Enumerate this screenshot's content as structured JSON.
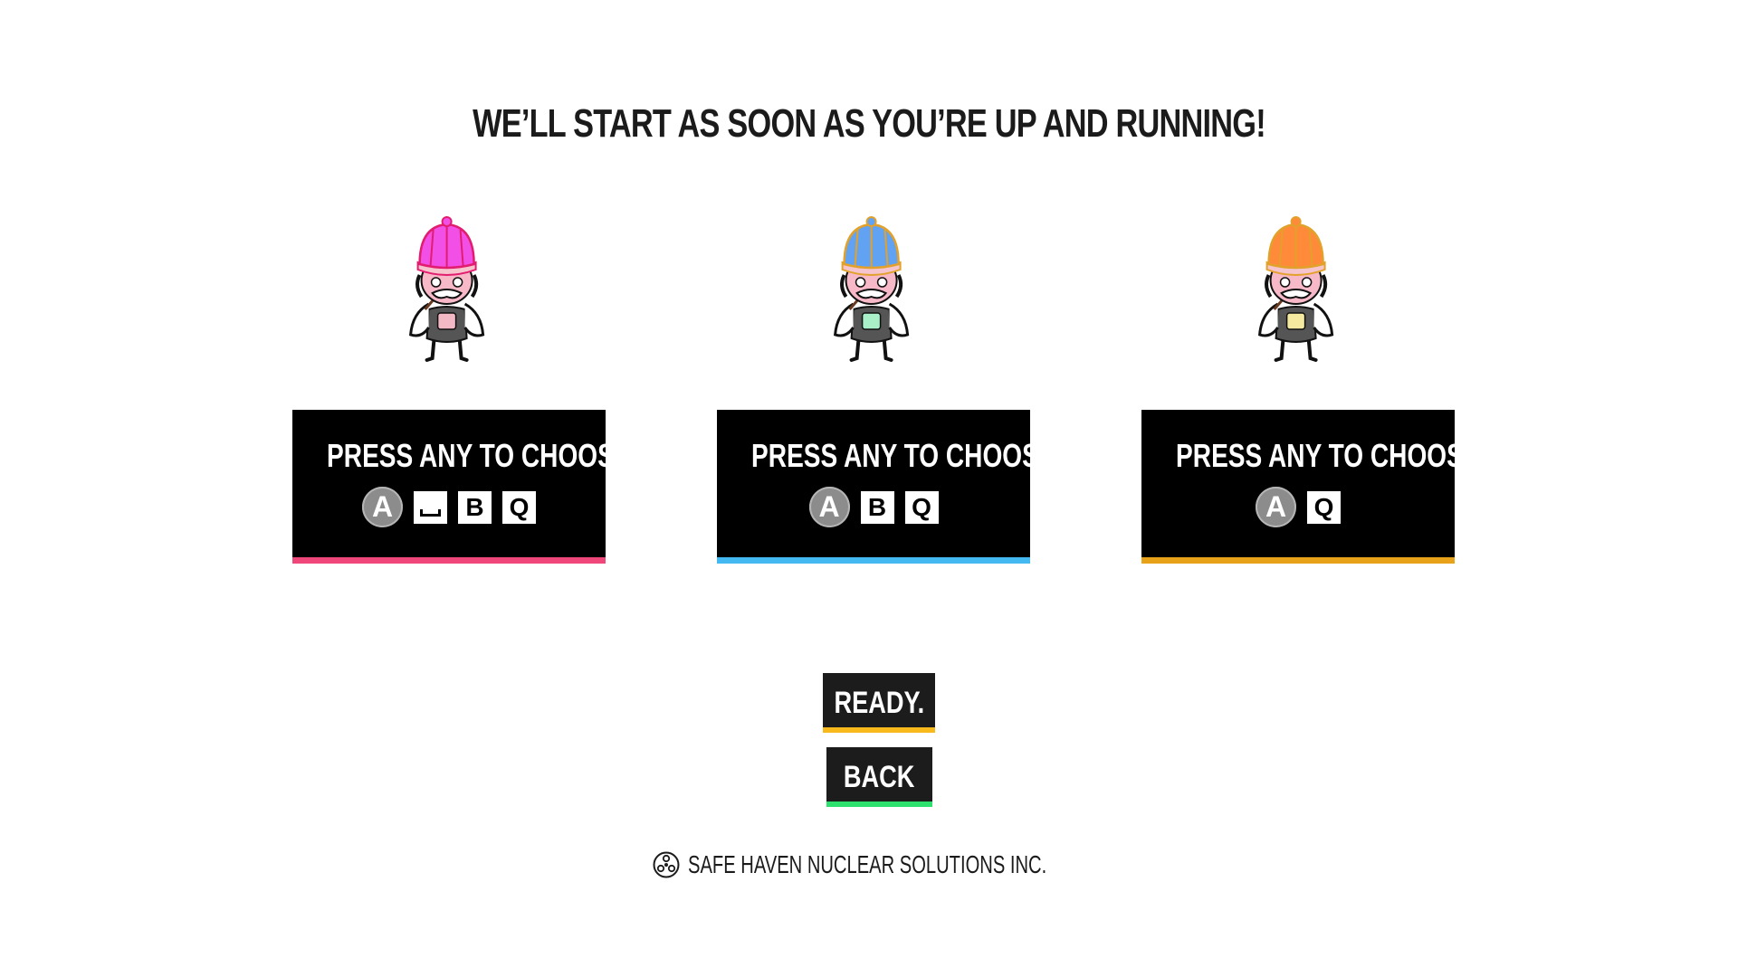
{
  "headline": "WE’LL START AS SOON AS YOU’RE UP AND RUNNING!",
  "players": [
    {
      "label": "PRESS ANY TO CHOOSE",
      "hat_color": "#f24fe6",
      "hat_stroke": "#e21d6f",
      "accent_color": "#f0477a",
      "belly_color": "#f2b8c4",
      "keys": [
        {
          "type": "circle",
          "label": "A"
        },
        {
          "type": "space",
          "label": ""
        },
        {
          "type": "square",
          "label": "B"
        },
        {
          "type": "square",
          "label": "Q"
        }
      ]
    },
    {
      "label": "PRESS ANY TO CHOOSE",
      "hat_color": "#62a2f2",
      "hat_stroke": "#e2a12a",
      "accent_color": "#44b8f0",
      "belly_color": "#a9f0c9",
      "keys": [
        {
          "type": "circle",
          "label": "A"
        },
        {
          "type": "square",
          "label": "B"
        },
        {
          "type": "square",
          "label": "Q"
        }
      ]
    },
    {
      "label": "PRESS ANY TO CHOOSE",
      "hat_color": "#ff8a3a",
      "hat_stroke": "#e2a12a",
      "accent_color": "#e8a21a",
      "belly_color": "#f5e9a0",
      "keys": [
        {
          "type": "circle",
          "label": "A"
        },
        {
          "type": "square",
          "label": "Q"
        }
      ]
    }
  ],
  "buttons": {
    "ready": {
      "label": "READY.",
      "accent": "#f7b91c"
    },
    "back": {
      "label": "BACK",
      "accent": "#2ee06e"
    }
  },
  "footer": {
    "icon": "radiation-icon",
    "text": "SAFE HAVEN NUCLEAR SOLUTIONS INC."
  }
}
